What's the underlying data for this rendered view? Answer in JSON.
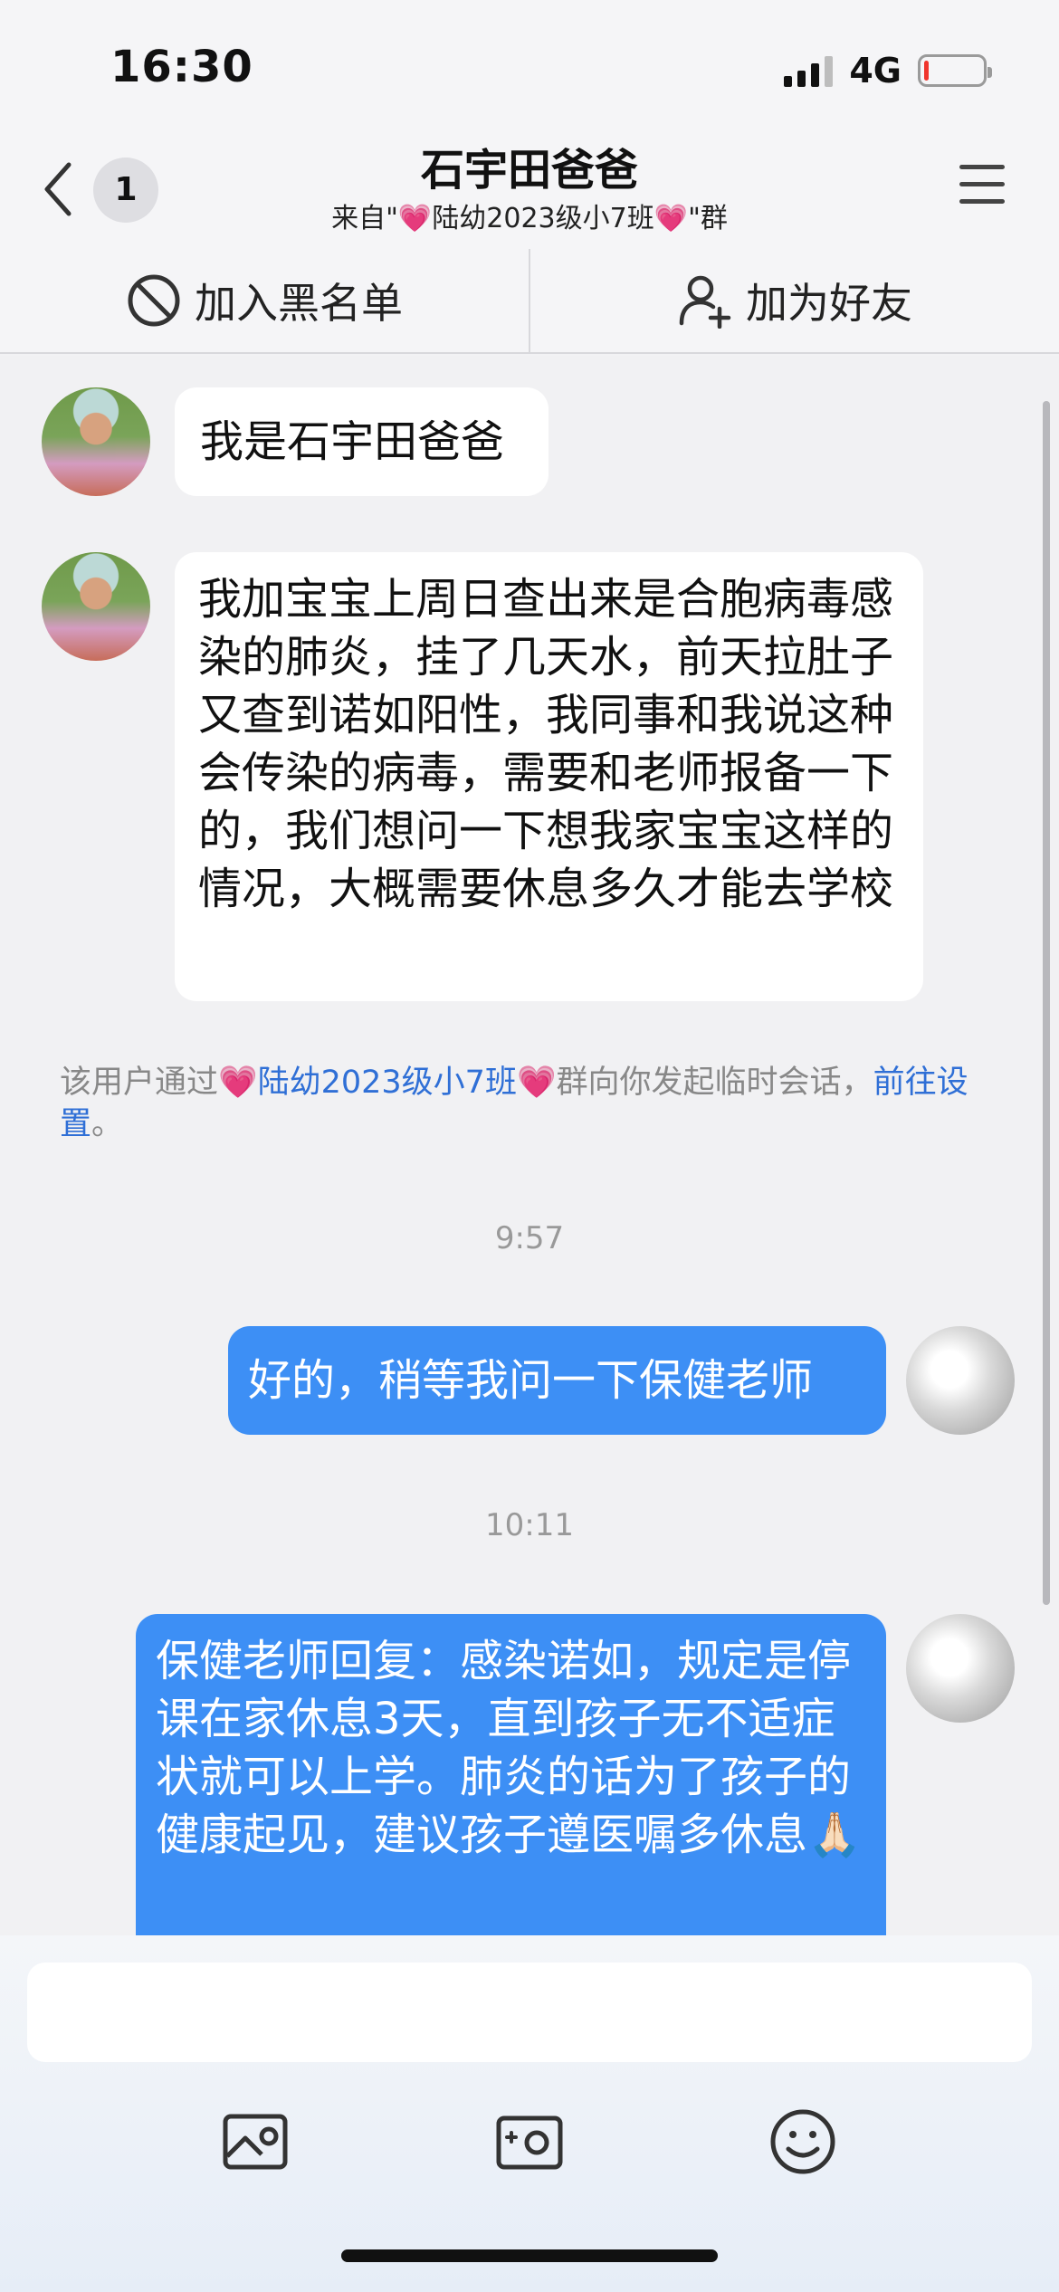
{
  "status_bar": {
    "time": "16:30",
    "network": "4G",
    "signal_bars_active": 3,
    "battery_level": 0.08,
    "battery_color": "#f0352d"
  },
  "nav": {
    "unread_count": "1",
    "title": "石宇田爸爸",
    "subtitle_prefix": "来自\"",
    "subtitle_group": "陆幼2023级小7班",
    "subtitle_suffix": "\"群",
    "heart_glyph": "💗",
    "back_icon": "chevron-left-icon",
    "menu_icon": "hamburger-menu-icon"
  },
  "actions": {
    "blacklist_label": "加入黑名单",
    "blacklist_icon": "block-icon",
    "add_friend_label": "加为好友",
    "add_friend_icon": "add-user-icon"
  },
  "messages": [
    {
      "sender": "石宇田爸爸",
      "direction": "incoming",
      "text": "我是石宇田爸爸"
    },
    {
      "sender": "石宇田爸爸",
      "direction": "incoming",
      "text": "我加宝宝上周日查出来是合胞病毒感染的肺炎，挂了几天水，前天拉肚子又查到诺如阳性，我同事和我说这种会传染的病毒，需要和老师报备一下的，我们想问一下想我家宝宝这样的情况，大概需要休息多久才能去学校"
    },
    {
      "direction": "outgoing",
      "text": "好的，稍等我问一下保健老师",
      "time_before": "9:57"
    },
    {
      "direction": "outgoing",
      "text": "保健老师回复：感染诺如，规定是停课在家休息3天，直到孩子无不适症状就可以上学。肺炎的话为了孩子的健康起见，建议孩子遵医嘱多休息🙏🏻",
      "time_before": "10:11"
    }
  ],
  "system_note": {
    "prefix": "该用户通过",
    "group": "陆幼2023级小7班",
    "middle": "群向你发起临时会话，",
    "link": "前往设置",
    "suffix": "。"
  },
  "timestamps": [
    "9:57",
    "10:11"
  ],
  "input": {
    "placeholder": "",
    "toolbar": [
      "image-icon",
      "camera-icon",
      "emoji-icon"
    ]
  },
  "colors": {
    "outgoing_bubble": "#3d8ff5",
    "link": "#2f6fd6",
    "heart": "#e0409a"
  }
}
